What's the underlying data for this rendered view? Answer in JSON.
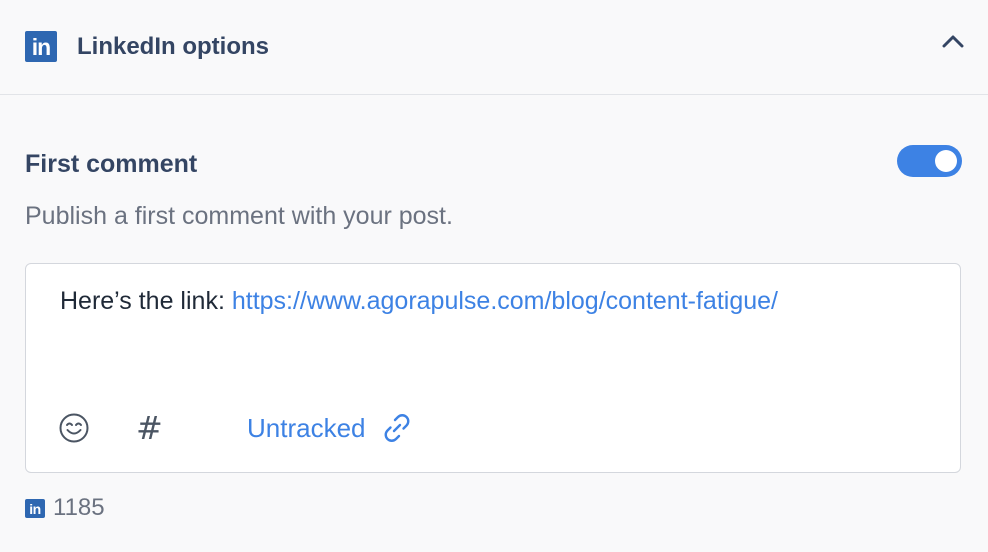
{
  "header": {
    "logo_text": "in",
    "title": "LinkedIn options",
    "collapse_icon": "chevron-up-icon"
  },
  "first_comment": {
    "title": "First comment",
    "enabled": true,
    "description": "Publish a first comment with your post.",
    "comment_prefix": "Here’s the link: ",
    "comment_link": "https://www.agorapulse.com/blog/content-fatigue/"
  },
  "toolbar": {
    "emoji_icon": "smiley-icon",
    "hashtag_label": "#",
    "tracking_label": "Untracked",
    "link_icon": "link-icon"
  },
  "footer": {
    "network_icon_text": "in",
    "character_count": "1185"
  },
  "colors": {
    "accent": "#3d82e4",
    "linkedin": "#2e67b1"
  }
}
